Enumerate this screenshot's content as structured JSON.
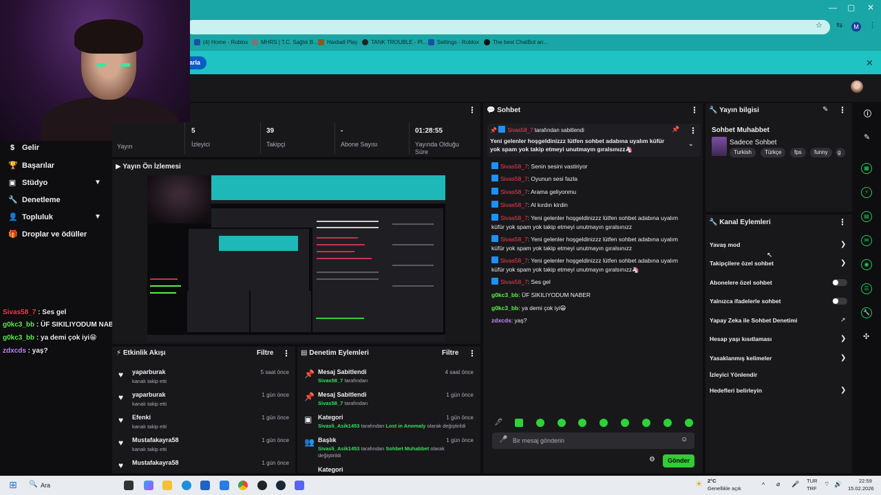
{
  "browser": {
    "bookmarks": [
      {
        "label": "(4) Home - Roblox"
      },
      {
        "label": "MHRS | T.C. Sağlık B..."
      },
      {
        "label": "Haxball Play"
      },
      {
        "label": "TANK TROUBLE - Pl..."
      },
      {
        "label": "Settings - Roblox"
      },
      {
        "label": "The best ChatBot an..."
      }
    ],
    "profile_initial": "M",
    "banner_button": "arla",
    "banner_close": "✕",
    "win_min": "—",
    "win_max": "▢",
    "win_close": "✕"
  },
  "leftnav": {
    "items": [
      {
        "label": "Gelir",
        "icon": "dollar-icon",
        "glyph": "$"
      },
      {
        "label": "Başarılar",
        "icon": "trophy-icon",
        "glyph": "🏆"
      },
      {
        "label": "Stüdyo",
        "icon": "camera-icon",
        "glyph": "▣"
      },
      {
        "label": "Denetleme",
        "icon": "wrench-icon",
        "glyph": "🔧"
      },
      {
        "label": "Topluluk",
        "icon": "user-icon",
        "glyph": "👤"
      },
      {
        "label": "Droplar ve ödüller",
        "icon": "gift-icon",
        "glyph": "🎁"
      }
    ]
  },
  "overlay_chat": [
    {
      "user": "Sivas58_7",
      "text": " : Ses gel",
      "color": "#ff3b4e"
    },
    {
      "user": "g0kc3_bb",
      "text": " : ÜF SIKILIYODUM NABER",
      "color": "#5ff04d"
    },
    {
      "user": "g0kc3_bb",
      "text": " : ya demi çok iyi😁",
      "color": "#5ff04d"
    },
    {
      "user": "zdxcds",
      "text": " : yaş?",
      "color": "#c58cff"
    }
  ],
  "stats": [
    {
      "value": "",
      "label": "Yayın"
    },
    {
      "value": "5",
      "label": "İzleyici"
    },
    {
      "value": "39",
      "label": "Takipçi"
    },
    {
      "value": "-",
      "label": "Abone Sayısı"
    },
    {
      "value": "01:28:55",
      "label": "Yayında Olduğu Süre"
    }
  ],
  "preview": {
    "title": "Yayın Ön İzlemesi"
  },
  "activity": {
    "title": "Etkinlik Akışı",
    "filter": "Filtre",
    "items": [
      {
        "user": "yaparburak",
        "action": "kanalı takip etti",
        "time": "5 saat önce"
      },
      {
        "user": "yaparburak",
        "action": "kanalı takip etti",
        "time": "1 gün önce"
      },
      {
        "user": "Efenki",
        "action": "kanalı takip etti",
        "time": "1 gün önce"
      },
      {
        "user": "Mustafakayra58",
        "action": "kanalı takip etti",
        "time": "1 gün önce"
      },
      {
        "user": "Mustafakayra58",
        "action": "",
        "time": "1 gün önce"
      }
    ]
  },
  "moderation": {
    "title": "Denetim Eylemleri",
    "filter": "Filtre",
    "items": [
      {
        "title": "Mesaj Sabitlendi",
        "time": "4 saat önce",
        "actor": "Sivas58_7",
        "rest": " tarafından",
        "rest2": "",
        "line2": ""
      },
      {
        "title": "Mesaj Sabitlendi",
        "time": "1 gün önce",
        "actor": "Sivas58_7",
        "rest": " tarafından",
        "rest2": "",
        "line2": ""
      },
      {
        "title": "Kategori",
        "time": "1 gün önce",
        "actor": "Sivasli_Asik1453",
        "rest": " tarafından ",
        "value": "Lost in Anomaly",
        "rest2": " olarak değiştirildi",
        "line2": ""
      },
      {
        "title": "Başlık",
        "time": "1 gün önce",
        "actor": "Sivasli_Asik1453",
        "rest": " tarafından ",
        "value": "Sohbet Muhabbet",
        "rest2": " olarak",
        "line2": "değiştirildi"
      },
      {
        "title": "Kategori",
        "time": "",
        "actor": "",
        "rest": "",
        "rest2": "",
        "line2": ""
      }
    ]
  },
  "chat": {
    "title": "Sohbet",
    "pinned": {
      "by_user": "Sivas58_7",
      "by_text": " tarafından sabitlendi",
      "message": "Yeni gelenler hoşgeldinizzz lütfen sohbet adabına uyalım küfür yok spam yok takip etmeyi unutmayın gıralsınızz🦄"
    },
    "messages": [
      {
        "user": "Sivas58_7",
        "text": ": Senin sesini vastiriyor",
        "style": "r",
        "badge": true
      },
      {
        "user": "Sivas58_7",
        "text": ": Oyunun sesi fazla",
        "style": "r",
        "badge": true
      },
      {
        "user": "Sivas58_7",
        "text": ": Arama geliyonmu",
        "style": "r",
        "badge": true
      },
      {
        "user": "Sivas58_7",
        "text": ": Al kırdın kirdin",
        "style": "r",
        "badge": true
      },
      {
        "user": "Sivas58_7",
        "text": ": Yeni gelenler hoşgeldinizzz lütfen sohbet adabına uyalım küfür yok spam yok takip etmeyi unutmayın gıralsınızz",
        "style": "r",
        "badge": true
      },
      {
        "user": "Sivas58_7",
        "text": ": Yeni gelenler hoşgeldinizzz lütfen sohbet adabına uyalım küfür yok spam yok takip etmeyi unutmayın gıralsınızz",
        "style": "r",
        "badge": true
      },
      {
        "user": "Sivas58_7",
        "text": ": Yeni gelenler hoşgeldinizzz lütfen sohbet adabına uyalım küfür yok spam yok takip etmeyi unutmayın gıralsınızz🦄",
        "style": "r",
        "badge": true
      },
      {
        "user": "Sivas58_7",
        "text": ": Ses gel",
        "style": "r",
        "badge": true
      },
      {
        "user": "g0kc3_bb",
        "text": ": ÜF SIKILIYODUM NABER",
        "style": "g",
        "badge": false
      },
      {
        "user": "g0kc3_bb",
        "text": ": ya demi çok iyi😁",
        "style": "g",
        "badge": false
      },
      {
        "user": "zdxcds",
        "text": ": yaş?",
        "style": "p",
        "badge": false
      }
    ],
    "input_placeholder": "Bir mesaj gönderin",
    "send": "Gönder"
  },
  "stream_info": {
    "title": "Yayın bilgisi",
    "stream_title": "Sohbet Muhabbet",
    "category": "Sadece Sohbet",
    "tags": [
      "Turkish",
      "Türkçe",
      "fps",
      "funny",
      "g"
    ]
  },
  "channel_actions": {
    "title": "Kanal Eylemleri",
    "items": [
      {
        "label": "Yavaş mod",
        "control": "chevron"
      },
      {
        "label": "Takipçilere özel sohbet",
        "control": "chevron"
      },
      {
        "label": "Abonelere özel sohbet",
        "control": "toggle"
      },
      {
        "label": "Yalnızca ifadelerle sohbet",
        "control": "toggle"
      },
      {
        "label": "Yapay Zeka ile Sohbet Denetimi",
        "control": "external"
      },
      {
        "label": "Hesap yaşı kısıtlaması",
        "control": "chevron"
      },
      {
        "label": "Yasaklanmış kelimeler",
        "control": "chevron"
      },
      {
        "label": "İzleyici Yönlendir",
        "control": "none"
      },
      {
        "label": "Hedefleri belirleyin",
        "control": "chevron"
      }
    ]
  },
  "taskbar": {
    "search": "Ara",
    "weather_temp": "2°C",
    "weather_desc": "Genellikle açık",
    "lang1": "TUR",
    "lang2": "TRF",
    "time": "22:59",
    "date": "15.02.2026"
  }
}
